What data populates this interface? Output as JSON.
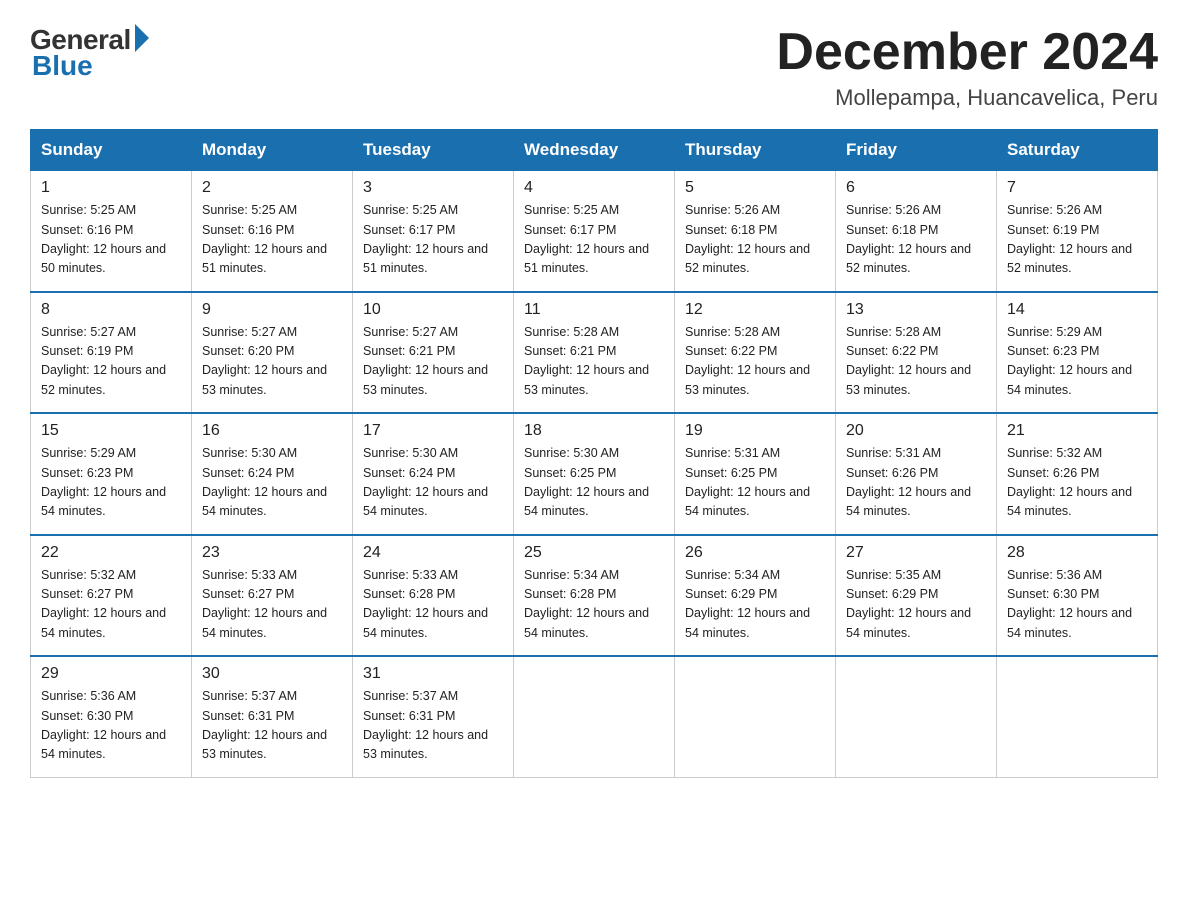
{
  "header": {
    "logo_general": "General",
    "logo_blue": "Blue",
    "month_year": "December 2024",
    "location": "Mollepampa, Huancavelica, Peru"
  },
  "days_of_week": [
    "Sunday",
    "Monday",
    "Tuesday",
    "Wednesday",
    "Thursday",
    "Friday",
    "Saturday"
  ],
  "weeks": [
    [
      {
        "day": "1",
        "sunrise": "5:25 AM",
        "sunset": "6:16 PM",
        "daylight": "12 hours and 50 minutes."
      },
      {
        "day": "2",
        "sunrise": "5:25 AM",
        "sunset": "6:16 PM",
        "daylight": "12 hours and 51 minutes."
      },
      {
        "day": "3",
        "sunrise": "5:25 AM",
        "sunset": "6:17 PM",
        "daylight": "12 hours and 51 minutes."
      },
      {
        "day": "4",
        "sunrise": "5:25 AM",
        "sunset": "6:17 PM",
        "daylight": "12 hours and 51 minutes."
      },
      {
        "day": "5",
        "sunrise": "5:26 AM",
        "sunset": "6:18 PM",
        "daylight": "12 hours and 52 minutes."
      },
      {
        "day": "6",
        "sunrise": "5:26 AM",
        "sunset": "6:18 PM",
        "daylight": "12 hours and 52 minutes."
      },
      {
        "day": "7",
        "sunrise": "5:26 AM",
        "sunset": "6:19 PM",
        "daylight": "12 hours and 52 minutes."
      }
    ],
    [
      {
        "day": "8",
        "sunrise": "5:27 AM",
        "sunset": "6:19 PM",
        "daylight": "12 hours and 52 minutes."
      },
      {
        "day": "9",
        "sunrise": "5:27 AM",
        "sunset": "6:20 PM",
        "daylight": "12 hours and 53 minutes."
      },
      {
        "day": "10",
        "sunrise": "5:27 AM",
        "sunset": "6:21 PM",
        "daylight": "12 hours and 53 minutes."
      },
      {
        "day": "11",
        "sunrise": "5:28 AM",
        "sunset": "6:21 PM",
        "daylight": "12 hours and 53 minutes."
      },
      {
        "day": "12",
        "sunrise": "5:28 AM",
        "sunset": "6:22 PM",
        "daylight": "12 hours and 53 minutes."
      },
      {
        "day": "13",
        "sunrise": "5:28 AM",
        "sunset": "6:22 PM",
        "daylight": "12 hours and 53 minutes."
      },
      {
        "day": "14",
        "sunrise": "5:29 AM",
        "sunset": "6:23 PM",
        "daylight": "12 hours and 54 minutes."
      }
    ],
    [
      {
        "day": "15",
        "sunrise": "5:29 AM",
        "sunset": "6:23 PM",
        "daylight": "12 hours and 54 minutes."
      },
      {
        "day": "16",
        "sunrise": "5:30 AM",
        "sunset": "6:24 PM",
        "daylight": "12 hours and 54 minutes."
      },
      {
        "day": "17",
        "sunrise": "5:30 AM",
        "sunset": "6:24 PM",
        "daylight": "12 hours and 54 minutes."
      },
      {
        "day": "18",
        "sunrise": "5:30 AM",
        "sunset": "6:25 PM",
        "daylight": "12 hours and 54 minutes."
      },
      {
        "day": "19",
        "sunrise": "5:31 AM",
        "sunset": "6:25 PM",
        "daylight": "12 hours and 54 minutes."
      },
      {
        "day": "20",
        "sunrise": "5:31 AM",
        "sunset": "6:26 PM",
        "daylight": "12 hours and 54 minutes."
      },
      {
        "day": "21",
        "sunrise": "5:32 AM",
        "sunset": "6:26 PM",
        "daylight": "12 hours and 54 minutes."
      }
    ],
    [
      {
        "day": "22",
        "sunrise": "5:32 AM",
        "sunset": "6:27 PM",
        "daylight": "12 hours and 54 minutes."
      },
      {
        "day": "23",
        "sunrise": "5:33 AM",
        "sunset": "6:27 PM",
        "daylight": "12 hours and 54 minutes."
      },
      {
        "day": "24",
        "sunrise": "5:33 AM",
        "sunset": "6:28 PM",
        "daylight": "12 hours and 54 minutes."
      },
      {
        "day": "25",
        "sunrise": "5:34 AM",
        "sunset": "6:28 PM",
        "daylight": "12 hours and 54 minutes."
      },
      {
        "day": "26",
        "sunrise": "5:34 AM",
        "sunset": "6:29 PM",
        "daylight": "12 hours and 54 minutes."
      },
      {
        "day": "27",
        "sunrise": "5:35 AM",
        "sunset": "6:29 PM",
        "daylight": "12 hours and 54 minutes."
      },
      {
        "day": "28",
        "sunrise": "5:36 AM",
        "sunset": "6:30 PM",
        "daylight": "12 hours and 54 minutes."
      }
    ],
    [
      {
        "day": "29",
        "sunrise": "5:36 AM",
        "sunset": "6:30 PM",
        "daylight": "12 hours and 54 minutes."
      },
      {
        "day": "30",
        "sunrise": "5:37 AM",
        "sunset": "6:31 PM",
        "daylight": "12 hours and 53 minutes."
      },
      {
        "day": "31",
        "sunrise": "5:37 AM",
        "sunset": "6:31 PM",
        "daylight": "12 hours and 53 minutes."
      },
      null,
      null,
      null,
      null
    ]
  ],
  "labels": {
    "sunrise_prefix": "Sunrise: ",
    "sunset_prefix": "Sunset: ",
    "daylight_prefix": "Daylight: "
  }
}
